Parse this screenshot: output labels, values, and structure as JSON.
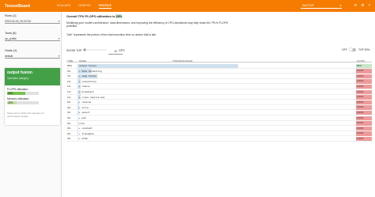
{
  "topbar": {
    "title": "TensorBoard",
    "nav": [
      "SCALARS",
      "GRAPHS",
      "PROFILE"
    ],
    "active_nav": "PROFILE",
    "search_label": "INACTIVE",
    "icons": [
      "refresh-icon",
      "settings-icon",
      "help-icon"
    ]
  },
  "sidebar": {
    "runs_label": "Runs (1)",
    "run_value": "2019-03-03_20:22:01/",
    "tools_label": "Tools (6)",
    "tool_value": "op_profile",
    "hosts_label": "Hosts (1)",
    "host_value": "default"
  },
  "card": {
    "title": "output fusion",
    "subtitle": "Operation category",
    "flops_label": "FLOPS utilization:",
    "flops_value": "58%",
    "flops_fraction": 0.58,
    "memory_label": "Memory utilization:",
    "memory_value": "30%",
    "memory_fraction": 0.3,
    "note": "Select items within this category for performance details"
  },
  "main": {
    "headline_prefix": "Overall TPU FLOPS utilization is",
    "headline_value": "29%",
    "para1": "Modifying your model's architecture, data dimensions, and improving the efficiency of CPU operations may help reach the TPU's FLOPS potential.",
    "para2": "\"Idle\" represents the portion of the total execution time on device that is idle.",
    "show_top_label": "SHOW TOP",
    "top_n": "10",
    "gps_label": "GPS",
    "off_label": "OFF",
    "top90_label": "TOP 90%"
  },
  "table": {
    "headers": {
      "time": "TIME",
      "name": "NAME",
      "title_col": "TODOEXPLOR EF",
      "flops": "FLOPS"
    },
    "rows": [
      {
        "time": "58%",
        "name": "output fusion",
        "bar": 0.58,
        "flops": "58%",
        "flops_color": "#c8e6c9",
        "expand": false
      },
      {
        "time": "5%",
        "name": "data formatting",
        "bar": 0.05,
        "flops": "0.00%",
        "flops_color": "#ef9a9a",
        "expand": true
      },
      {
        "time": "7%",
        "name": "loop fusion",
        "bar": 0.07,
        "flops": "0.00%",
        "flops_color": "#ef9a9a",
        "expand": true
      },
      {
        "time": "1%",
        "name": "convolution",
        "bar": 0.01,
        "flops": "0.00%",
        "flops_color": "#ef9a9a",
        "expand": true
      },
      {
        "time": "1%",
        "name": "reduce",
        "bar": 0.01,
        "flops": "0.00%",
        "flops_color": "#ef9a9a",
        "expand": true
      },
      {
        "time": "1%",
        "name": "broadcast",
        "bar": 0.01,
        "flops": "0.00%",
        "flops_color": "#ef9a9a",
        "expand": true
      },
      {
        "time": "1%",
        "name": "cross-replica-sum",
        "bar": 0.01,
        "flops": "0.00%",
        "flops_color": "#ef9a9a",
        "expand": true
      },
      {
        "time": "0%",
        "name": "reverse",
        "bar": 0.005,
        "flops": "0.00%",
        "flops_color": "#ef9a9a",
        "expand": true
      },
      {
        "time": "0%",
        "name": "slice",
        "bar": 0.005,
        "flops": "0.00%",
        "flops_color": "#ef9a9a",
        "expand": true
      },
      {
        "time": "0%",
        "name": "select",
        "bar": 0.005,
        "flops": "0.00%",
        "flops_color": "#ef9a9a",
        "expand": true
      },
      {
        "time": "0%",
        "name": "pad",
        "bar": 0.004,
        "flops": "0.00%",
        "flops_color": "#ef9a9a",
        "expand": true
      },
      {
        "time": "0%",
        "name": "idle",
        "bar": 0.004,
        "flops": "0.00%",
        "flops_color": "#ef9a9a",
        "expand": false
      },
      {
        "time": "0%",
        "name": "constant",
        "bar": 0.003,
        "flops": "0.00%",
        "flops_color": "#ef9a9a",
        "expand": true
      },
      {
        "time": "0%",
        "name": "transpose",
        "bar": 0.003,
        "flops": "0.00%",
        "flops_color": "#ef9a9a",
        "expand": true
      },
      {
        "time": "0%",
        "name": "other",
        "bar": 0.003,
        "flops": "0.00%",
        "flops_color": "#ef9a9a",
        "expand": true
      }
    ]
  },
  "colors": {
    "accent": "#f57c00",
    "card_header": "#43a047",
    "time_bar": "#cfe0ee",
    "good": "#c8e6c9",
    "bad": "#ef9a9a"
  }
}
